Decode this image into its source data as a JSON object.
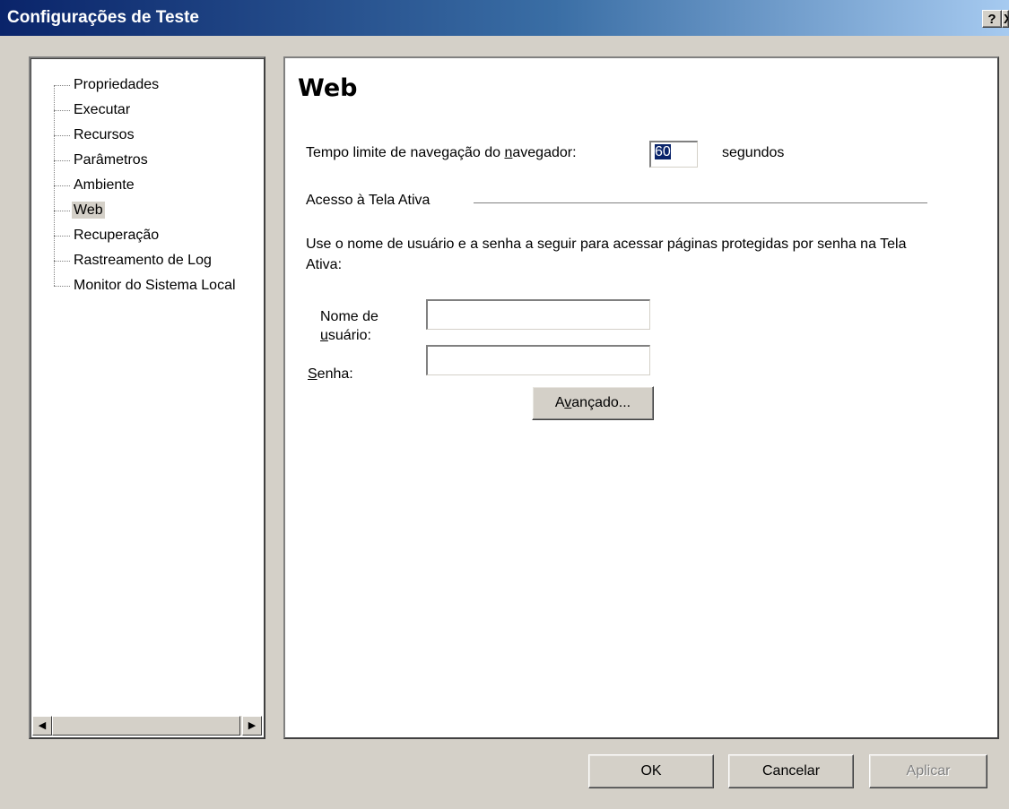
{
  "window": {
    "title": "Configurações de Teste",
    "help_button": "?",
    "close_button": "X"
  },
  "tree": {
    "items": [
      {
        "label": "Propriedades"
      },
      {
        "label": "Executar"
      },
      {
        "label": "Recursos"
      },
      {
        "label": "Parâmetros"
      },
      {
        "label": "Ambiente"
      },
      {
        "label": "Web",
        "selected": true
      },
      {
        "label": "Recuperação"
      },
      {
        "label": "Rastreamento de Log"
      },
      {
        "label": "Monitor do Sistema Local"
      }
    ],
    "scroll_left_icon": "◀",
    "scroll_right_icon": "▶"
  },
  "web": {
    "title": "Web",
    "timeout": {
      "label_before": "Tempo limite de navegação do ",
      "label_mnemonic": "n",
      "label_after": "avegador:",
      "value": "60",
      "unit": "segundos"
    },
    "active_screen": {
      "group_label": "Acesso à Tela Ativa",
      "description": "Use o nome de usuário e a senha a seguir para acessar páginas protegidas por senha na Tela Ativa:",
      "username_label_line1": "Nome de",
      "username_label_mnemonic": "u",
      "username_label_line2_rest": "suário:",
      "username_value": "",
      "password_label_mnemonic": "S",
      "password_label_rest": "enha:",
      "password_value": "",
      "advanced_before": "A",
      "advanced_mnemonic": "v",
      "advanced_after": "ançado..."
    }
  },
  "buttons": {
    "ok": "OK",
    "cancel": "Cancelar",
    "apply": "Aplicar"
  }
}
